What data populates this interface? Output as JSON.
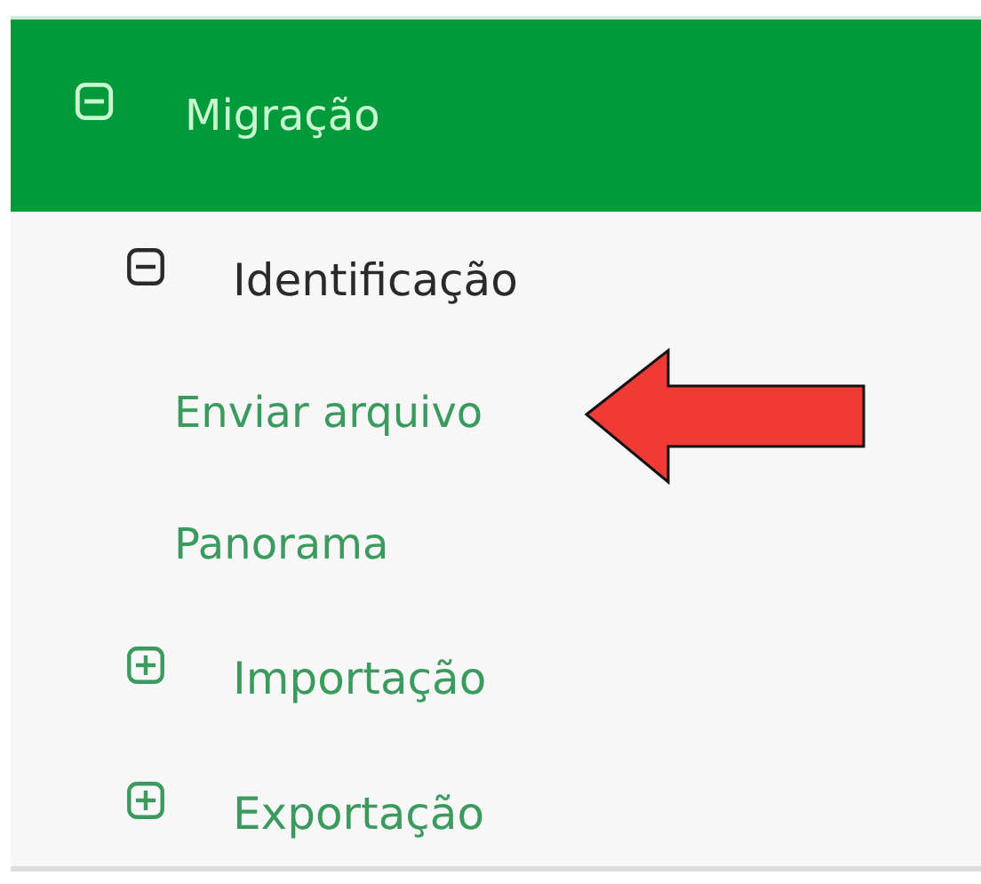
{
  "menu": [
    {
      "label": "Migração",
      "expanded": true,
      "selected": true,
      "children": [
        {
          "label": "Identificação",
          "expanded": true,
          "selected": true,
          "children": [
            {
              "label": "Enviar arquivo",
              "selected": false
            },
            {
              "label": "Panorama",
              "selected": false
            }
          ]
        },
        {
          "label": "Importação",
          "expanded": false,
          "selected": false
        },
        {
          "label": "Exportação",
          "expanded": false,
          "selected": false
        }
      ]
    }
  ]
}
